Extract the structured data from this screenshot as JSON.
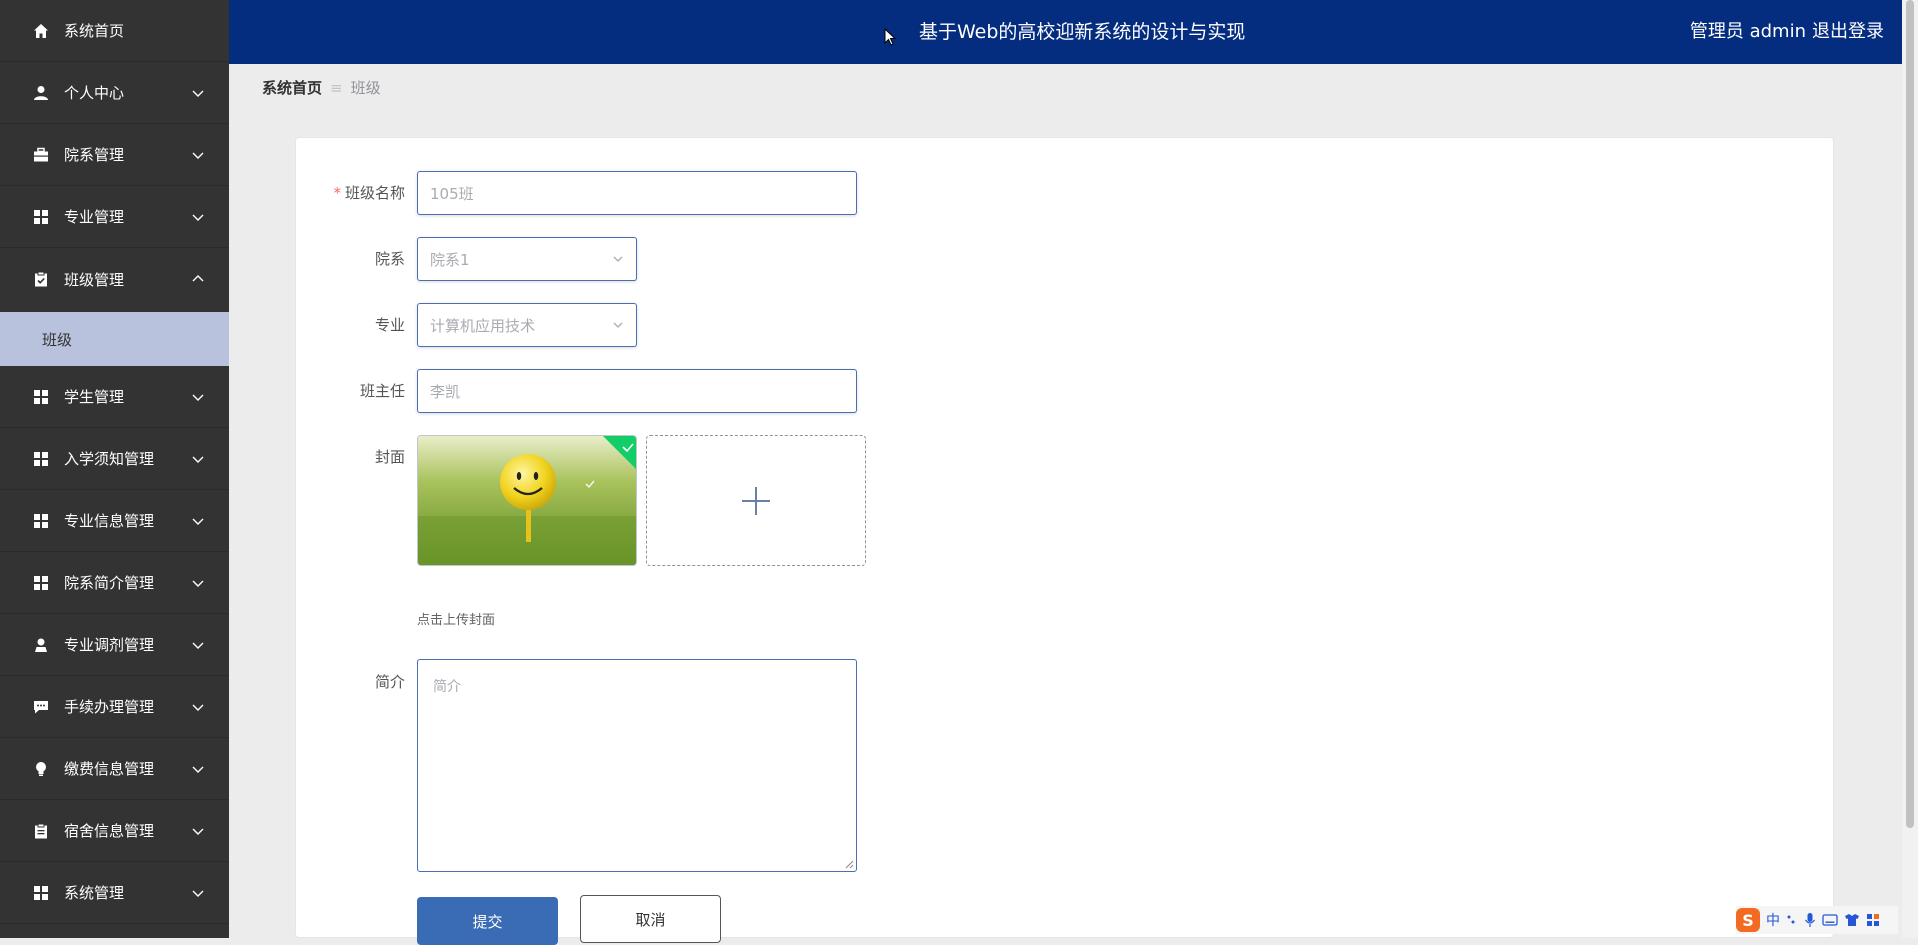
{
  "header": {
    "title": "基于Web的高校迎新系统的设计与实现",
    "user": "管理员 admin",
    "logout": "退出登录"
  },
  "sidebar": {
    "items": [
      {
        "label": "系统首页",
        "icon": "home-icon"
      },
      {
        "label": "个人中心",
        "icon": "user-icon"
      },
      {
        "label": "院系管理",
        "icon": "briefcase-icon"
      },
      {
        "label": "专业管理",
        "icon": "grid-icon"
      },
      {
        "label": "班级管理",
        "icon": "clipboard-check-icon"
      },
      {
        "label": "学生管理",
        "icon": "grid-icon"
      },
      {
        "label": "入学须知管理",
        "icon": "grid-icon"
      },
      {
        "label": "专业信息管理",
        "icon": "grid-icon"
      },
      {
        "label": "院系简介管理",
        "icon": "grid-icon"
      },
      {
        "label": "专业调剂管理",
        "icon": "person-icon"
      },
      {
        "label": "手续办理管理",
        "icon": "chat-icon"
      },
      {
        "label": "缴费信息管理",
        "icon": "lightbulb-icon"
      },
      {
        "label": "宿舍信息管理",
        "icon": "clipboard-icon"
      },
      {
        "label": "系统管理",
        "icon": "grid-icon"
      }
    ],
    "subitem": "班级"
  },
  "breadcrumb": {
    "home": "系统首页",
    "separator": "≡",
    "current": "班级"
  },
  "form": {
    "class_name_label": "班级名称",
    "class_name_value": "105班",
    "department_label": "院系",
    "department_value": "院系1",
    "major_label": "专业",
    "major_value": "计算机应用技术",
    "teacher_label": "班主任",
    "teacher_value": "李凯",
    "cover_label": "封面",
    "cover_hint": "点击上传封面",
    "intro_label": "简介",
    "intro_placeholder": "简介",
    "submit": "提交",
    "cancel": "取消"
  },
  "ime": {
    "logo": "S",
    "mode": "中"
  },
  "colors": {
    "sidebar_bg": "#333333",
    "header_bg": "#042c7f",
    "active_subitem_bg": "#b9c2dc",
    "submit_bg": "#3a6bb5",
    "input_border": "#4b6cb7"
  }
}
